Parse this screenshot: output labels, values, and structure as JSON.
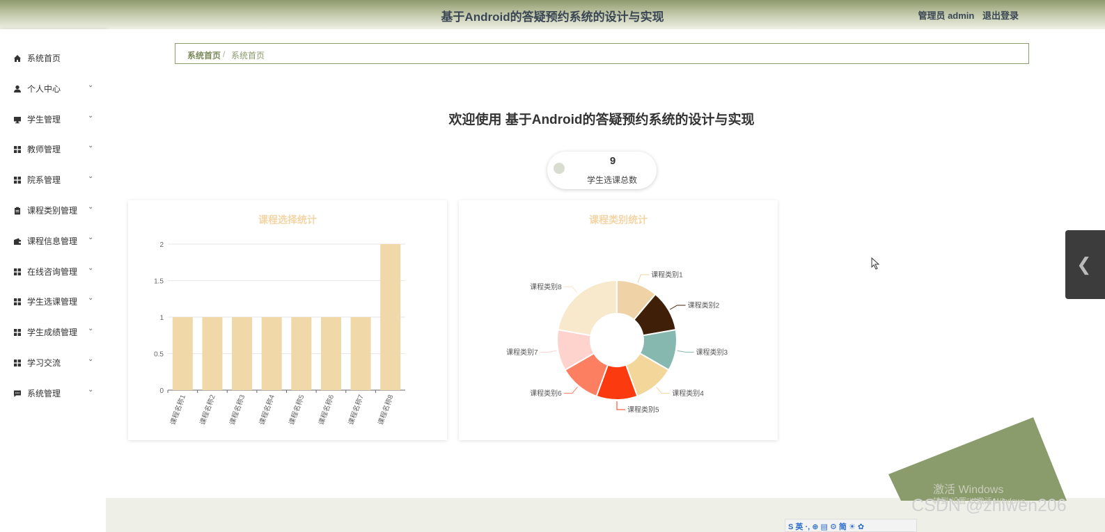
{
  "header": {
    "title": "基于Android的答疑预约系统的设计与实现",
    "user_label": "管理员 admin",
    "logout_label": "退出登录"
  },
  "sidebar": {
    "items": [
      {
        "label": "系统首页",
        "icon": "home-icon",
        "expandable": false
      },
      {
        "label": "个人中心",
        "icon": "user-icon",
        "expandable": true
      },
      {
        "label": "学生管理",
        "icon": "monitor-icon",
        "expandable": true
      },
      {
        "label": "教师管理",
        "icon": "grid-icon",
        "expandable": true
      },
      {
        "label": "院系管理",
        "icon": "grid-icon",
        "expandable": true
      },
      {
        "label": "课程类别管理",
        "icon": "clipboard-icon",
        "expandable": true
      },
      {
        "label": "课程信息管理",
        "icon": "wallet-icon",
        "expandable": true
      },
      {
        "label": "在线咨询管理",
        "icon": "grid-icon",
        "expandable": true
      },
      {
        "label": "学生选课管理",
        "icon": "grid-icon",
        "expandable": true
      },
      {
        "label": "学生成绩管理",
        "icon": "grid-icon",
        "expandable": true
      },
      {
        "label": "学习交流",
        "icon": "grid-icon",
        "expandable": true
      },
      {
        "label": "系统管理",
        "icon": "chat-icon",
        "expandable": true
      }
    ]
  },
  "breadcrumb": {
    "home": "系统首页",
    "separator": "/",
    "current": "系统首页"
  },
  "welcome": "欢迎使用 基于Android的答疑预约系统的设计与实现",
  "stat": {
    "value": "9",
    "caption": "学生选课总数"
  },
  "colors": {
    "accent": "#8a9b6c",
    "bar": "#f0d8a8",
    "chart_title": "#f3d5a6"
  },
  "side_tab": {
    "icon": "chevron-left-icon"
  },
  "os_overlay": {
    "activate_title": "激活 Windows",
    "activate_sub": "转到\"设置\"以激活 Windows。",
    "watermark": "CSDN @zhiwen206",
    "taskbar_text": "S 英 ·, ⊕ ▤ ⚙ 简 ☀ ✿"
  },
  "chart_data": [
    {
      "type": "bar",
      "title": "课程选择统计",
      "categories": [
        "课程名称1",
        "课程名称2",
        "课程名称3",
        "课程名称4",
        "课程名称5",
        "课程名称6",
        "课程名称7",
        "课程名称8"
      ],
      "values": [
        1,
        1,
        1,
        1,
        1,
        1,
        1,
        2
      ],
      "yticks": [
        "0",
        "0.5",
        "1",
        "1.5",
        "2"
      ],
      "ylim": [
        0,
        2
      ],
      "grid": true,
      "color": "#f0d8a8"
    },
    {
      "type": "pie",
      "title": "课程类别统计",
      "donut": true,
      "labels": [
        "课程类别1",
        "课程类别2",
        "课程类别3",
        "课程类别4",
        "课程类别5",
        "课程类别6",
        "课程类别7",
        "课程类别8"
      ],
      "values": [
        1,
        1,
        1,
        1,
        1,
        1,
        1,
        2
      ],
      "colors": [
        "#efd3a6",
        "#3f1f08",
        "#86b8b0",
        "#f3d699",
        "#fb3a10",
        "#fd7f62",
        "#fed2cd",
        "#f8e8cc"
      ]
    }
  ]
}
